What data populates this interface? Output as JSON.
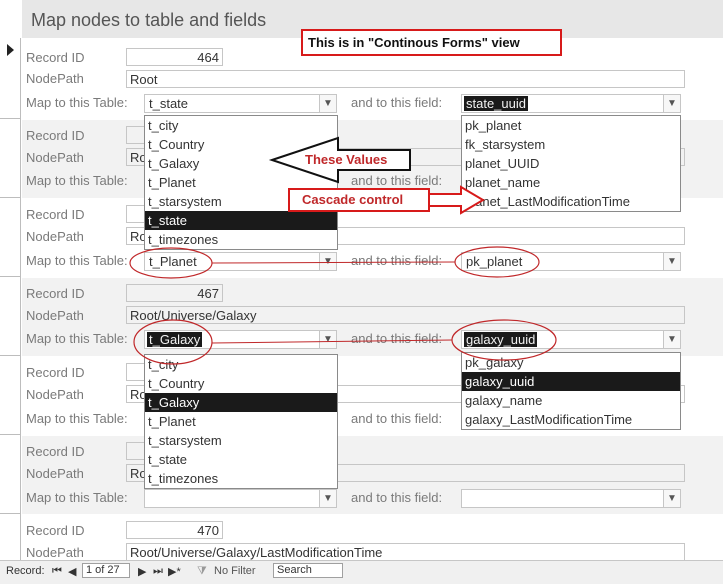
{
  "title": "Map nodes to table and fields",
  "note": "This is in \"Continous Forms\" view",
  "labels": {
    "record_id": "Record ID",
    "node_path": "NodePath",
    "map_table": "Map to this Table:",
    "map_field": "and to this field:"
  },
  "records": [
    {
      "id": "464",
      "path": "Root",
      "table": "t_state",
      "field": "state_uuid"
    },
    {
      "id": "",
      "path": "Ro",
      "table": "",
      "field": ""
    },
    {
      "id": "",
      "path": "Ro",
      "table": "t_Planet",
      "field": "pk_planet"
    },
    {
      "id": "467",
      "path": "Root/Universe/Galaxy",
      "table": "t_Galaxy",
      "field": "galaxy_uuid"
    },
    {
      "id": "",
      "path": "Ro",
      "table": "",
      "field": ""
    },
    {
      "id": "",
      "path": "Ro",
      "table": "",
      "field": ""
    },
    {
      "id": "470",
      "path": "Root/Universe/Galaxy/LastModificationTime",
      "table": "",
      "field": ""
    }
  ],
  "dropdown_tables_1": [
    "t_city",
    "t_Country",
    "t_Galaxy",
    "t_Planet",
    "t_starsystem",
    "t_state",
    "t_timezones"
  ],
  "dropdown_fields_1": [
    "pk_planet",
    "fk_starsystem",
    "planet_UUID",
    "planet_name",
    "planet_LastModificationTime"
  ],
  "dropdown_tables_2": [
    "t_city",
    "t_Country",
    "t_Galaxy",
    "t_Planet",
    "t_starsystem",
    "t_state",
    "t_timezones"
  ],
  "dropdown_fields_2": [
    "pk_galaxy",
    "galaxy_uuid",
    "galaxy_name",
    "galaxy_LastModificationTime"
  ],
  "annotations": {
    "values": "These Values",
    "cascade": "Cascade control"
  },
  "nav": {
    "record_label": "Record:",
    "first": "⏮",
    "prev": "◀",
    "position": "1 of 27",
    "next": "▶",
    "last": "⏭",
    "new": "▶*",
    "filter": "No Filter",
    "search": "Search"
  },
  "colors": {
    "annotation_red": "#c0282a",
    "selection": "#1a1a1a",
    "band_alt": "#f2f2f2"
  }
}
